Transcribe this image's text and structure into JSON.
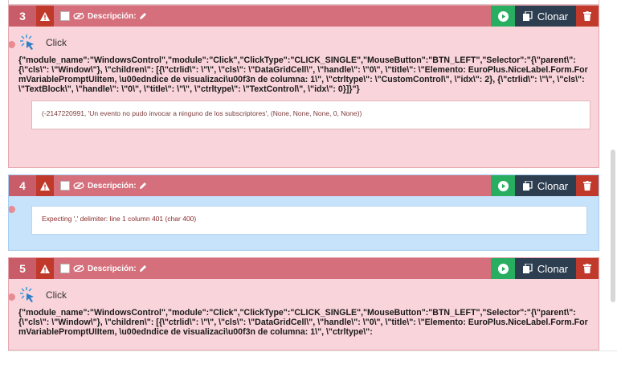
{
  "steps": [
    {
      "number": "3",
      "description_label": "Descripción:",
      "clone_label": "Clonar",
      "action_name": "Click",
      "json_text": "{\"module_name\":\"WindowsControl\",\"module\":\"Click\",\"ClickType\":\"CLICK_SINGLE\",\"MouseButton\":\"BTN_LEFT\",\"Selector\":\"{\\\"parent\\\": {\\\"cls\\\": \\\"Window\\\"}, \\\"children\\\": [{\\\"ctrlid\\\": \\\"\\\", \\\"cls\\\": \\\"DataGridCell\\\", \\\"handle\\\": \\\"0\\\", \\\"title\\\": \\\"Elemento: EuroPlus.NiceLabel.Form.FormVariablePromptUIItem, \\u00edndice de visualizaci\\u00f3n de columna: 1\\\", \\\"ctrltype\\\": \\\"CustomControl\\\", \\\"idx\\\": 2}, {\\\"ctrlid\\\": \\\"\\\", \\\"cls\\\": \\\"TextBlock\\\", \\\"handle\\\": \\\"0\\\", \\\"title\\\": \\\"\\\", \\\"ctrltype\\\": \\\"TextControl\\\", \\\"idx\\\": 0}]}\"}",
      "result_text": "(-2147220991, 'Un evento no pudo invocar a ninguno de los subscriptores', (None, None, None, 0, None))"
    },
    {
      "number": "4",
      "description_label": "Descripción:",
      "clone_label": "Clonar",
      "result_text": "Expecting ',' delimiter: line 1 column 401 (char 400)"
    },
    {
      "number": "5",
      "description_label": "Descripción:",
      "clone_label": "Clonar",
      "action_name": "Click",
      "json_text": "{\"module_name\":\"WindowsControl\",\"module\":\"Click\",\"ClickType\":\"CLICK_SINGLE\",\"MouseButton\":\"BTN_LEFT\",\"Selector\":\"{\\\"parent\\\": {\\\"cls\\\": \\\"Window\\\"}, \\\"children\\\": [{\\\"ctrlid\\\": \\\"\\\", \\\"cls\\\": \\\"DataGridCell\\\", \\\"handle\\\": \\\"0\\\", \\\"title\\\": \\\"Elemento: EuroPlus.NiceLabel.Form.FormVariablePromptUIItem, \\u00edndice de visualizaci\\u00f3n de columna: 1\\\", \\\"ctrltype\\\":"
    }
  ],
  "colors": {
    "header": "#d46f7b",
    "card_error": "#f9d4da",
    "card_info": "#c7e2fb",
    "run": "#27ae60",
    "clone": "#2c3e50",
    "delete": "#c0392b"
  },
  "icons": [
    "warning-icon",
    "eye-slash-icon",
    "pencil-icon",
    "play-icon",
    "copy-icon",
    "trash-icon",
    "click-cursor-icon"
  ]
}
